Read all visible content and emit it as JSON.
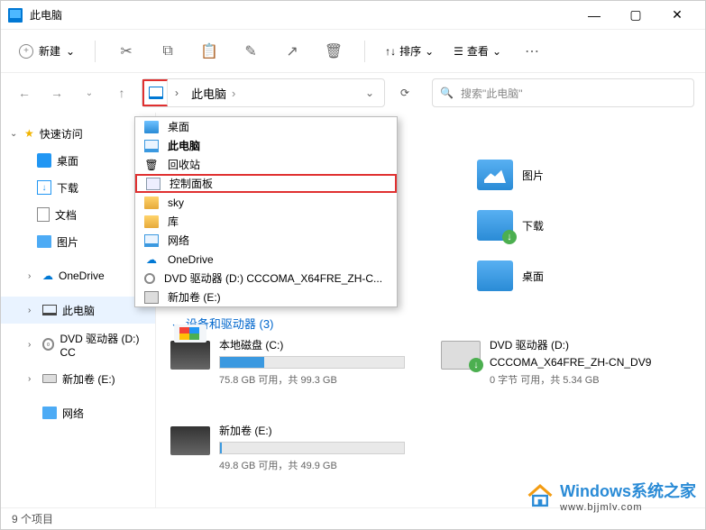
{
  "title": "此电脑",
  "toolbar": {
    "new_label": "新建",
    "sort_label": "排序",
    "view_label": "查看"
  },
  "address": {
    "current": "此电脑"
  },
  "search": {
    "placeholder": "搜索\"此电脑\""
  },
  "sidebar": {
    "quick_access": "快速访问",
    "desktop": "桌面",
    "downloads": "下载",
    "documents": "文档",
    "pictures": "图片",
    "onedrive": "OneDrive",
    "this_pc": "此电脑",
    "dvd": "DVD 驱动器 (D:) CC",
    "new_volume": "新加卷 (E:)",
    "network": "网络"
  },
  "dropdown": {
    "items": [
      {
        "label": "桌面"
      },
      {
        "label": "此电脑"
      },
      {
        "label": "回收站"
      },
      {
        "label": "控制面板"
      },
      {
        "label": "sky"
      },
      {
        "label": "库"
      },
      {
        "label": "网络"
      },
      {
        "label": "OneDrive"
      },
      {
        "label": "DVD 驱动器 (D:) CCCOMA_X64FRE_ZH-C..."
      },
      {
        "label": "新加卷 (E:)"
      }
    ]
  },
  "folders": {
    "pictures": "图片",
    "downloads": "下载",
    "desktop": "桌面"
  },
  "section": {
    "devices": "设备和驱动器 (3)"
  },
  "drives": {
    "c": {
      "name": "本地磁盘 (C:)",
      "stat": "75.8 GB 可用，共 99.3 GB",
      "fill_pct": 24
    },
    "d": {
      "name": "DVD 驱动器 (D:)",
      "sub": "CCCOMA_X64FRE_ZH-CN_DV9",
      "stat": "0 字节 可用，共 5.34 GB"
    },
    "e": {
      "name": "新加卷 (E:)",
      "stat": "49.8 GB 可用，共 49.9 GB",
      "fill_pct": 1
    }
  },
  "status": "9 个项目",
  "watermark": {
    "line1": "Windows系统之家",
    "line2": "www.bjjmlv.com"
  }
}
